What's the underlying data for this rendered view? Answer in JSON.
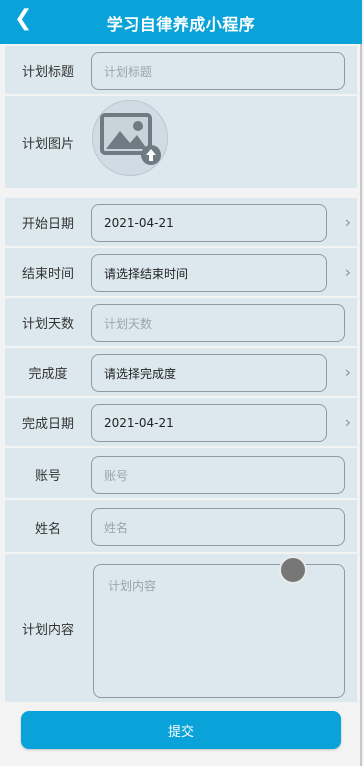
{
  "header": {
    "title": "学习自律养成小程序"
  },
  "form": {
    "plan_title": {
      "label": "计划标题",
      "placeholder": "计划标题"
    },
    "plan_image": {
      "label": "计划图片"
    },
    "start_date": {
      "label": "开始日期",
      "value": "2021-04-21"
    },
    "end_time": {
      "label": "结束时间",
      "value": "请选择结束时间"
    },
    "plan_days": {
      "label": "计划天数",
      "placeholder": "计划天数"
    },
    "completion": {
      "label": "完成度",
      "value": "请选择完成度"
    },
    "complete_date": {
      "label": "完成日期",
      "value": "2021-04-21"
    },
    "account": {
      "label": "账号",
      "placeholder": "账号"
    },
    "name": {
      "label": "姓名",
      "placeholder": "姓名"
    },
    "plan_content": {
      "label": "计划内容",
      "placeholder": "计划内容"
    }
  },
  "submit": {
    "label": "提交"
  },
  "colors": {
    "accent": "#0aa3d9",
    "panel": "#dce8ee"
  },
  "icons": {
    "back": "chevron-left-icon",
    "upload": "image-upload-icon",
    "chevron": "chevron-right-icon"
  }
}
